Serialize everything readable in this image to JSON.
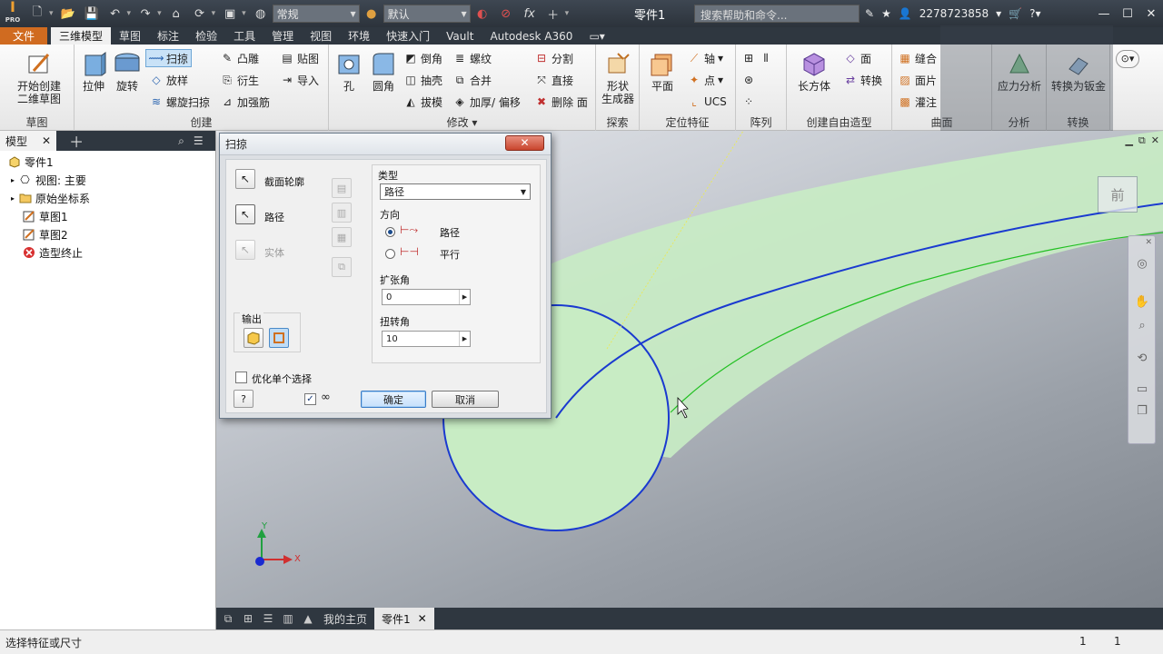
{
  "app": {
    "title": "零件1",
    "style_combo": "常规",
    "appearance_combo": "默认",
    "search_placeholder": "搜索帮助和命令...",
    "user": "2278723858"
  },
  "tabs": [
    "文件",
    "三维模型",
    "草图",
    "标注",
    "检验",
    "工具",
    "管理",
    "视图",
    "环境",
    "快速入门",
    "Vault",
    "Autodesk A360"
  ],
  "ribbon": {
    "sketch": {
      "title": "草图",
      "start_sketch": "开始创建\n二维草图"
    },
    "create": {
      "title": "创建",
      "extrude": "拉伸",
      "revolve": "旋转",
      "sweep": "扫掠",
      "loft": "放样",
      "coil": "螺旋扫掠",
      "emboss": "凸雕",
      "derive": "衍生",
      "rib": "加强筋",
      "decal": "贴图",
      "import": "导入"
    },
    "modify": {
      "title": "修改 ▾",
      "hole": "孔",
      "fillet": "圆角",
      "chamfer": "倒角",
      "shell": "抽壳",
      "draft": "拔模",
      "thread": "螺纹",
      "combine": "合并",
      "thicken": "加厚/ 偏移",
      "split": "分割",
      "direct": "直接",
      "delete_face": "删除 面"
    },
    "explore": {
      "title": "探索",
      "shape_gen": "形状\n生成器"
    },
    "work": {
      "title": "定位特征",
      "plane": "平面",
      "axis": "轴",
      "point": "点",
      "ucs": "UCS"
    },
    "pattern": {
      "title": "阵列"
    },
    "freeform": {
      "title": "创建自由造型",
      "box": "长方体",
      "face": "面",
      "convert": "转换"
    },
    "surface": {
      "title": "曲面",
      "stitch": "缝合",
      "patch": "面片",
      "sculpt": "灌注"
    },
    "analysis": {
      "title": "分析",
      "stress": "应力分析"
    },
    "convert_panel": {
      "title": "转换",
      "sheet_metal": "转换为钣金"
    }
  },
  "browser": {
    "tab": "模型",
    "items": [
      "零件1",
      "视图: 主要",
      "原始坐标系",
      "草图1",
      "草图2",
      "造型终止"
    ]
  },
  "dialog": {
    "title": "扫掠",
    "profile": "截面轮廓",
    "path": "路径",
    "solid": "实体",
    "output": "输出",
    "type_label": "类型",
    "type_value": "路径",
    "direction": "方向",
    "dir_path": "路径",
    "dir_parallel": "平行",
    "taper_label": "扩张角",
    "taper_value": "0",
    "twist_label": "扭转角",
    "twist_value": "10",
    "optimize": "优化单个选择",
    "ok": "确定",
    "cancel": "取消"
  },
  "viewcube": {
    "face": "前"
  },
  "doctabs": {
    "home": "我的主页",
    "doc": "零件1"
  },
  "status": {
    "text": "选择特征或尺寸",
    "n1": "1",
    "n2": "1"
  },
  "colors": {
    "accent": "#d06b20",
    "sweep_fill": "#c8ecc4",
    "path_blue": "#1a3ad0",
    "path_green": "#22c022"
  }
}
